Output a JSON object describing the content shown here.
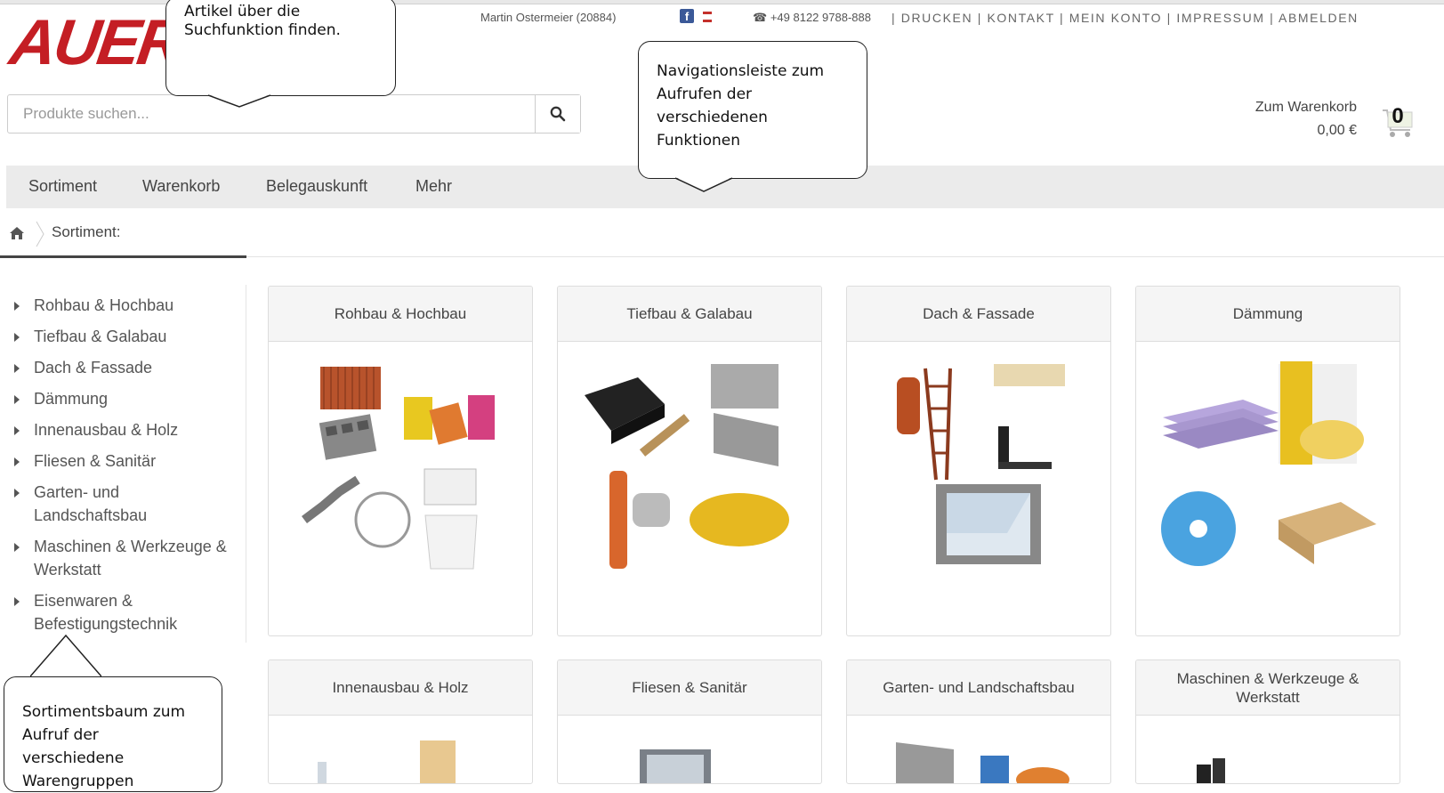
{
  "brand": {
    "logo_text": "AUER",
    "logo_color": "#c41e24"
  },
  "topbar": {
    "user": "Martin Ostermeier (20884)",
    "phone": "+49 8122 9788-888",
    "links": [
      "DRUCKEN",
      "KONTAKT",
      "MEIN KONTO",
      "IMPRESSUM",
      "ABMELDEN"
    ],
    "separator": "|",
    "facebook_icon": "facebook-icon",
    "youtube_icon": "youtube-icon"
  },
  "search": {
    "placeholder": "Produkte suchen...",
    "value": "",
    "icon": "search-icon"
  },
  "cart": {
    "label": "Zum Warenkorb",
    "total": "0,00 €",
    "count": "0",
    "icon": "cart-icon"
  },
  "nav": {
    "items": [
      "Sortiment",
      "Warenkorb",
      "Belegauskunft",
      "Mehr"
    ]
  },
  "breadcrumb": {
    "home_icon": "home-icon",
    "current": "Sortiment:"
  },
  "sidebar": {
    "items": [
      "Rohbau & Hochbau",
      "Tiefbau & Galabau",
      "Dach & Fassade",
      "Dämmung",
      "Innenausbau & Holz",
      "Fliesen & Sanitär",
      "Garten- und Landschaftsbau",
      "Maschinen & Werkzeuge & Werkstatt",
      "Eisenwaren & Befestigungstechnik"
    ]
  },
  "categories": [
    "Rohbau & Hochbau",
    "Tiefbau & Galabau",
    "Dach & Fassade",
    "Dämmung",
    "Innenausbau & Holz",
    "Fliesen & Sanitär",
    "Garten- und Landschaftsbau",
    "Maschinen & Werkzeuge & Werkstatt"
  ],
  "callouts": {
    "search": "Artikel über die Suchfunktion finden.",
    "navigation": "Navigationsleiste zum Aufrufen der verschiedenen Funktionen",
    "tree": "Sortimentsbaum zum Aufruf der verschiedene Warengruppen"
  }
}
